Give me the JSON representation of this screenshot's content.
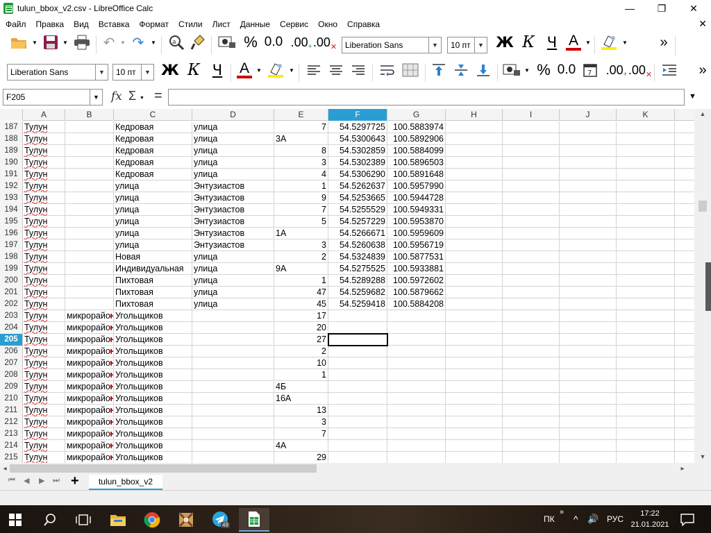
{
  "window": {
    "title": "tulun_bbox_v2.csv - LibreOffice Calc",
    "minimize_glyph": "—",
    "maximize_glyph": "❐",
    "close_glyph": "✕"
  },
  "menu": {
    "items": [
      "Файл",
      "Правка",
      "Вид",
      "Вставка",
      "Формат",
      "Стили",
      "Лист",
      "Данные",
      "Сервис",
      "Окно",
      "Справка"
    ],
    "doc_close_glyph": "✕"
  },
  "toolbar1": {
    "percent": "%",
    "number": "0.0",
    "add_decimal": ".00",
    "del_decimal": ".00",
    "font_name": "Liberation Sans",
    "font_size": "10 пт",
    "bold": "Ж",
    "italic": "К",
    "underline": "Ч",
    "font_color": "A",
    "more": "»"
  },
  "toolbar2": {
    "font_name": "Liberation Sans",
    "font_size": "10 пт",
    "bold": "Ж",
    "italic": "К",
    "underline": "Ч",
    "font_color": "A",
    "percent": "%",
    "number": "0.0",
    "add_decimal": ".00",
    "del_decimal": ".00",
    "more": "»"
  },
  "formula_bar": {
    "name_box": "F205",
    "fx": "fx",
    "sum": "Σ",
    "equals": "=",
    "value": ""
  },
  "colors": {
    "selection_header": "#2a9ed4",
    "font_color_red": "#cc0000",
    "highlight_yellow": "#ffee00",
    "calc_green": "#1e9b3b"
  },
  "grid": {
    "columns": [
      "A",
      "B",
      "C",
      "D",
      "E",
      "F",
      "G",
      "H",
      "I",
      "J",
      "K"
    ],
    "selected_column": "F",
    "selected_row": "205",
    "rows": [
      {
        "n": "187",
        "A": "Тулун",
        "B": "",
        "C": "Кедровая",
        "D": "улица",
        "E": "7",
        "F": "54.5297725",
        "G": "100.5883974"
      },
      {
        "n": "188",
        "A": "Тулун",
        "B": "",
        "C": "Кедровая",
        "D": "улица",
        "E": "3А",
        "F": "54.5300643",
        "G": "100.5892906"
      },
      {
        "n": "189",
        "A": "Тулун",
        "B": "",
        "C": "Кедровая",
        "D": "улица",
        "E": "8",
        "F": "54.5302859",
        "G": "100.5884099"
      },
      {
        "n": "190",
        "A": "Тулун",
        "B": "",
        "C": "Кедровая",
        "D": "улица",
        "E": "3",
        "F": "54.5302389",
        "G": "100.5896503"
      },
      {
        "n": "191",
        "A": "Тулун",
        "B": "",
        "C": "Кедровая",
        "D": "улица",
        "E": "4",
        "F": "54.5306290",
        "G": "100.5891648"
      },
      {
        "n": "192",
        "A": "Тулун",
        "B": "",
        "C": "улица",
        "D": "Энтузиастов",
        "E": "1",
        "F": "54.5262637",
        "G": "100.5957990"
      },
      {
        "n": "193",
        "A": "Тулун",
        "B": "",
        "C": "улица",
        "D": "Энтузиастов",
        "E": "9",
        "F": "54.5253665",
        "G": "100.5944728"
      },
      {
        "n": "194",
        "A": "Тулун",
        "B": "",
        "C": "улица",
        "D": "Энтузиастов",
        "E": "7",
        "F": "54.5255529",
        "G": "100.5949331"
      },
      {
        "n": "195",
        "A": "Тулун",
        "B": "",
        "C": "улица",
        "D": "Энтузиастов",
        "E": "5",
        "F": "54.5257229",
        "G": "100.5953870"
      },
      {
        "n": "196",
        "A": "Тулун",
        "B": "",
        "C": "улица",
        "D": "Энтузиастов",
        "E": "1А",
        "F": "54.5266671",
        "G": "100.5959609"
      },
      {
        "n": "197",
        "A": "Тулун",
        "B": "",
        "C": "улица",
        "D": "Энтузиастов",
        "E": "3",
        "F": "54.5260638",
        "G": "100.5956719"
      },
      {
        "n": "198",
        "A": "Тулун",
        "B": "",
        "C": "Новая",
        "D": "улица",
        "E": "2",
        "F": "54.5324839",
        "G": "100.5877531"
      },
      {
        "n": "199",
        "A": "Тулун",
        "B": "",
        "C": "Индивидуальная",
        "D": "улица",
        "E": "9А",
        "F": "54.5275525",
        "G": "100.5933881"
      },
      {
        "n": "200",
        "A": "Тулун",
        "B": "",
        "C": "Пихтовая",
        "D": "улица",
        "E": "1",
        "F": "54.5289288",
        "G": "100.5972602"
      },
      {
        "n": "201",
        "A": "Тулун",
        "B": "",
        "C": "Пихтовая",
        "D": "улица",
        "E": "47",
        "F": "54.5259682",
        "G": "100.5879662"
      },
      {
        "n": "202",
        "A": "Тулун",
        "B": "",
        "C": "Пихтовая",
        "D": "улица",
        "E": "45",
        "F": "54.5259418",
        "G": "100.5884208"
      },
      {
        "n": "203",
        "A": "Тулун",
        "B": "микрорайон",
        "C": "Угольщиков",
        "D": "",
        "E": "17",
        "F": "",
        "G": ""
      },
      {
        "n": "204",
        "A": "Тулун",
        "B": "микрорайон",
        "C": "Угольщиков",
        "D": "",
        "E": "20",
        "F": "",
        "G": ""
      },
      {
        "n": "205",
        "A": "Тулун",
        "B": "микрорайон",
        "C": "Угольщиков",
        "D": "",
        "E": "27",
        "F": "",
        "G": ""
      },
      {
        "n": "206",
        "A": "Тулун",
        "B": "микрорайон",
        "C": "Угольщиков",
        "D": "",
        "E": "2",
        "F": "",
        "G": ""
      },
      {
        "n": "207",
        "A": "Тулун",
        "B": "микрорайон",
        "C": "Угольщиков",
        "D": "",
        "E": "10",
        "F": "",
        "G": ""
      },
      {
        "n": "208",
        "A": "Тулун",
        "B": "микрорайон",
        "C": "Угольщиков",
        "D": "",
        "E": "1",
        "F": "",
        "G": ""
      },
      {
        "n": "209",
        "A": "Тулун",
        "B": "микрорайон",
        "C": "Угольщиков",
        "D": "",
        "E": "4Б",
        "F": "",
        "G": ""
      },
      {
        "n": "210",
        "A": "Тулун",
        "B": "микрорайон",
        "C": "Угольщиков",
        "D": "",
        "E": "16А",
        "F": "",
        "G": ""
      },
      {
        "n": "211",
        "A": "Тулун",
        "B": "микрорайон",
        "C": "Угольщиков",
        "D": "",
        "E": "13",
        "F": "",
        "G": ""
      },
      {
        "n": "212",
        "A": "Тулун",
        "B": "микрорайон",
        "C": "Угольщиков",
        "D": "",
        "E": "3",
        "F": "",
        "G": ""
      },
      {
        "n": "213",
        "A": "Тулун",
        "B": "микрорайон",
        "C": "Угольщиков",
        "D": "",
        "E": "7",
        "F": "",
        "G": ""
      },
      {
        "n": "214",
        "A": "Тулун",
        "B": "микрорайон",
        "C": "Угольщиков",
        "D": "",
        "E": "4А",
        "F": "",
        "G": ""
      },
      {
        "n": "215",
        "A": "Тулун",
        "B": "микрорайон",
        "C": "Угольщиков",
        "D": "",
        "E": "29",
        "F": "",
        "G": ""
      }
    ]
  },
  "sheets": {
    "tabs": [
      "tulun_bbox_v2"
    ],
    "add_label": "+"
  },
  "taskbar": {
    "tray_lang_short": "ПК",
    "tray_up": "^",
    "tray_volume": "🔊",
    "tray_lang": "РУС",
    "time": "17:22",
    "date": "21.01.2021",
    "telegram_badge": "49"
  }
}
